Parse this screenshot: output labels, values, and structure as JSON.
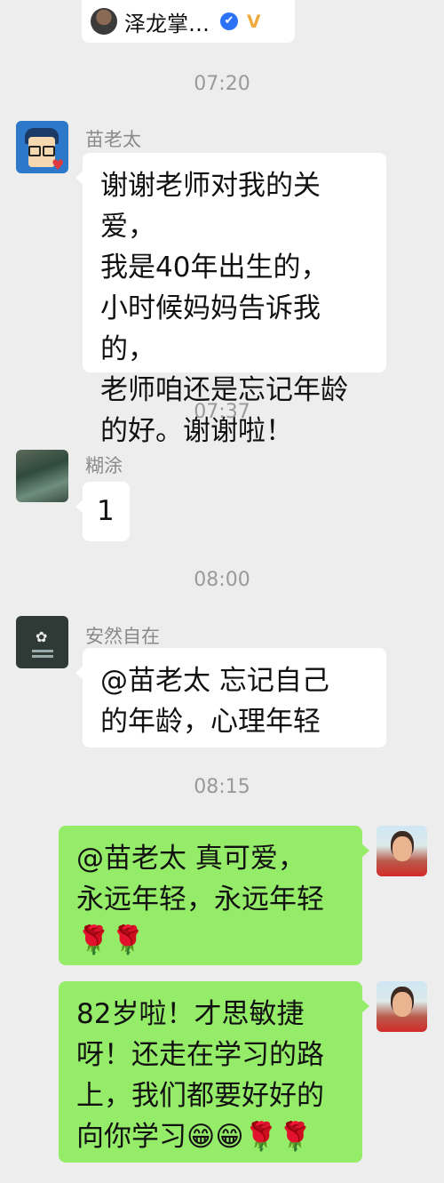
{
  "header": {
    "name": "泽龙掌…",
    "verified_glyph": "✔",
    "badge_glyph": "ᐯ"
  },
  "messages": [
    {
      "time": "07:20",
      "sender": "苗老太",
      "text": "谢谢老师对我的关爱，\n我是40年出生的，\n小时候妈妈告诉我的，\n老师咱还是忘记年龄\n的好。谢谢啦！",
      "side": "left",
      "avatar": "cartoon-avatar"
    },
    {
      "time": "07:37",
      "sender": "糊涂",
      "text": "1",
      "side": "left",
      "avatar": "landscape-avatar"
    },
    {
      "time": "08:00",
      "sender": "安然自在",
      "text": "@苗老太  忘记自己\n的年龄，心理年轻",
      "side": "left",
      "avatar": "flower-avatar"
    },
    {
      "time": "08:15",
      "sender": "",
      "text": "@苗老太  真可爱，\n永远年轻，永远年轻\n🌹🌹",
      "side": "right",
      "avatar": "self-avatar"
    },
    {
      "time": "",
      "sender": "",
      "text": "82岁啦！才思敏捷\n呀！还走在学习的路\n上，我们都要好好的\n向你学习😁😁🌹🌹",
      "side": "right",
      "avatar": "self-avatar"
    }
  ],
  "colors": {
    "background": "#ededed",
    "bubble_left": "#ffffff",
    "bubble_right": "#95ec69",
    "timestamp": "#9a9a9a"
  }
}
